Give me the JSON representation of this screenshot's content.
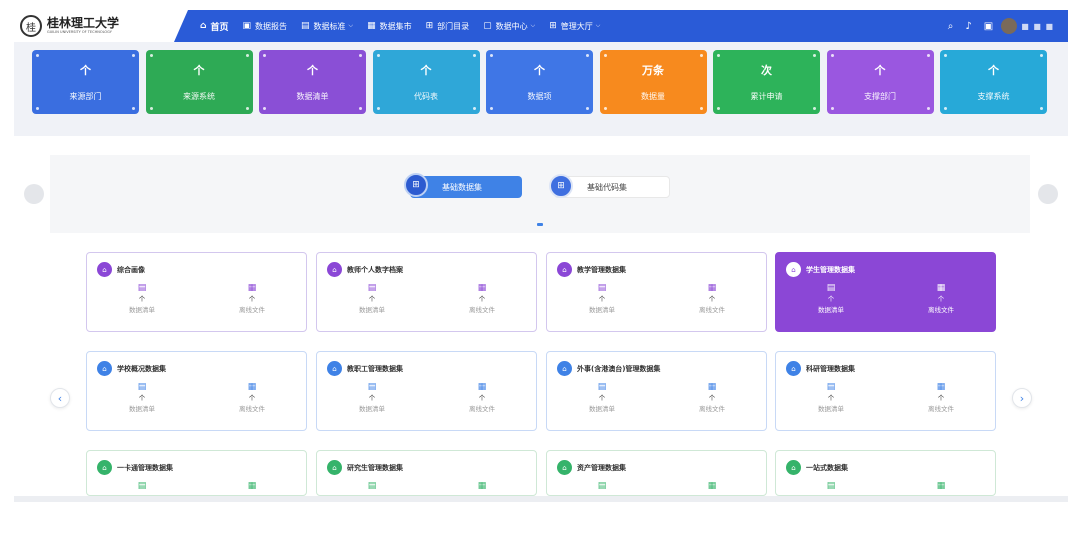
{
  "header": {
    "logo_seal": "桂",
    "logo_cn": "桂林理工大学",
    "logo_en": "GUILIN UNIVERSITY OF TECHNOLOGY",
    "nav": [
      {
        "label": "首页",
        "icon": "home-icon",
        "glyph": "⌂",
        "active": true,
        "dropdown": false
      },
      {
        "label": "数据报告",
        "icon": "report-icon",
        "glyph": "▣",
        "active": false,
        "dropdown": false
      },
      {
        "label": "数据标准",
        "icon": "standard-icon",
        "glyph": "▤",
        "active": false,
        "dropdown": true
      },
      {
        "label": "数据集市",
        "icon": "market-icon",
        "glyph": "▦",
        "active": false,
        "dropdown": false
      },
      {
        "label": "部门目录",
        "icon": "directory-icon",
        "glyph": "⊞",
        "active": false,
        "dropdown": false
      },
      {
        "label": "数据中心",
        "icon": "datacenter-icon",
        "glyph": "▢",
        "active": false,
        "dropdown": true
      },
      {
        "label": "管理大厅",
        "icon": "grid-icon",
        "glyph": "⊞",
        "active": false,
        "dropdown": true
      }
    ],
    "user_name": "■ ■ ■"
  },
  "stats": [
    {
      "value": "个",
      "label": "来源部门",
      "color": "#3a6ee0"
    },
    {
      "value": "个",
      "label": "来源系统",
      "color": "#2eaa55"
    },
    {
      "value": "个",
      "label": "数据清单",
      "color": "#8a4fd6"
    },
    {
      "value": "个",
      "label": "代码表",
      "color": "#2fa7d8"
    },
    {
      "value": "个",
      "label": "数据项",
      "color": "#3f76e6"
    },
    {
      "value": "万条",
      "label": "数据量",
      "color": "#f78a1e"
    },
    {
      "value": "次",
      "label": "累计申请",
      "color": "#2db35a"
    },
    {
      "value": "个",
      "label": "支撑部门",
      "color": "#9a57e0"
    },
    {
      "value": "个",
      "label": "支撑系统",
      "color": "#27a9d8"
    }
  ],
  "toggle": {
    "primary_label": "基础数据集",
    "secondary_label": "基础代码集"
  },
  "metric_labels": {
    "list": "数据清单",
    "file": "离线文件",
    "unit": "个"
  },
  "cards": [
    {
      "title": "综合画像",
      "theme": "purple",
      "selected": false
    },
    {
      "title": "教师个人数字档案",
      "theme": "purple",
      "selected": false
    },
    {
      "title": "教学管理数据集",
      "theme": "purple",
      "selected": false
    },
    {
      "title": "学生管理数据集",
      "theme": "purple",
      "selected": true
    },
    {
      "title": "学校概况数据集",
      "theme": "blue",
      "selected": false
    },
    {
      "title": "教职工管理数据集",
      "theme": "blue",
      "selected": false
    },
    {
      "title": "外事(含港澳台)管理数据集",
      "theme": "blue",
      "selected": false
    },
    {
      "title": "科研管理数据集",
      "theme": "blue",
      "selected": false
    },
    {
      "title": "一卡通管理数据集",
      "theme": "green",
      "selected": false
    },
    {
      "title": "研究生管理数据集",
      "theme": "green",
      "selected": false
    },
    {
      "title": "资产管理数据集",
      "theme": "green",
      "selected": false
    },
    {
      "title": "一站式数据集",
      "theme": "green",
      "selected": false
    }
  ],
  "colors": {
    "header": "#2a5bd7",
    "purple": "#8b47d6",
    "blue": "#3f82e6",
    "green": "#35b36a"
  }
}
